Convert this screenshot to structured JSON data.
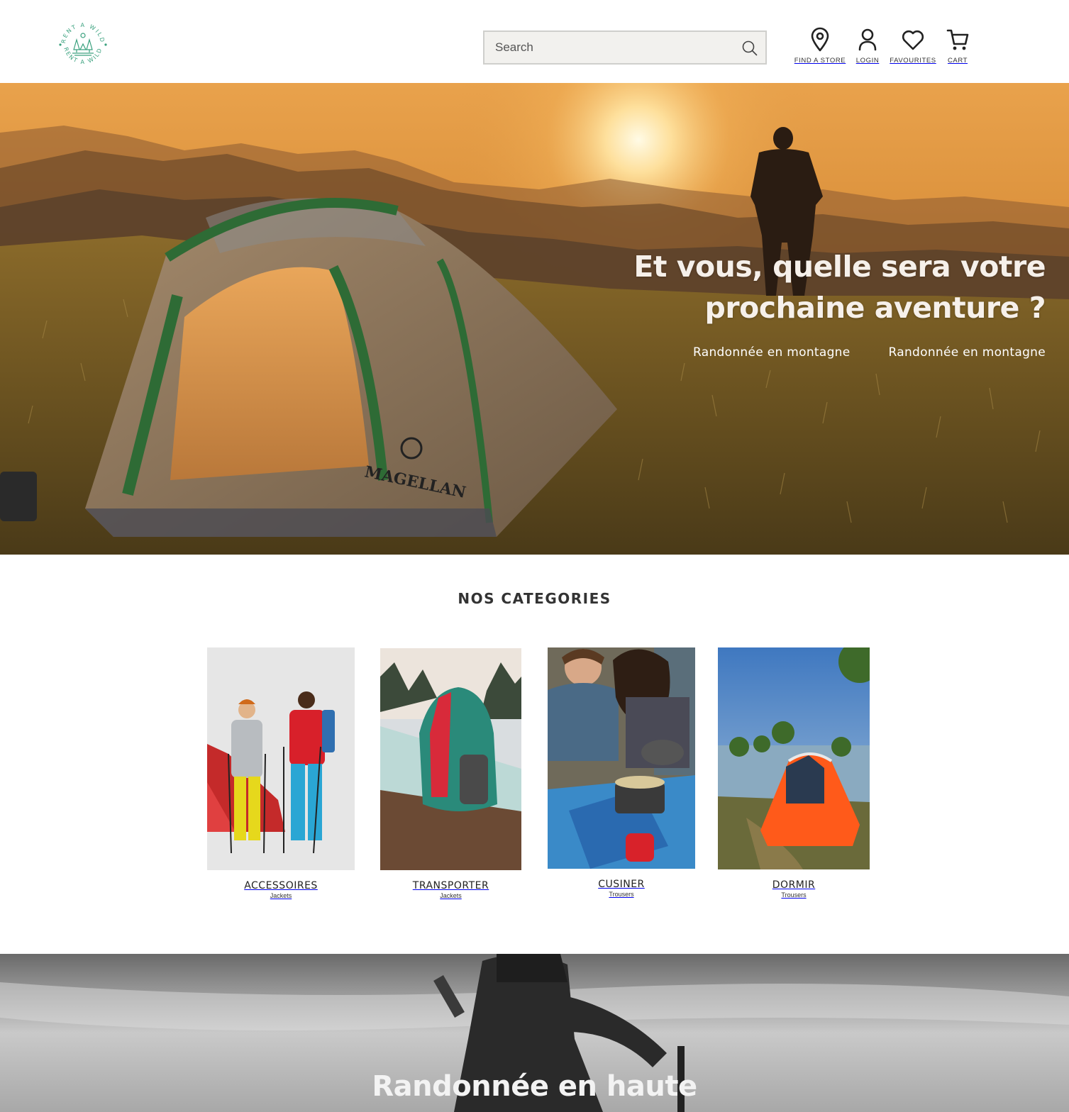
{
  "brand": {
    "logo_alt": "Rent a Wild",
    "logo_text_top": "RENT A WILD",
    "logo_text_bottom": "RENT A WILD",
    "accent_color": "#3aa17e"
  },
  "search": {
    "placeholder": "Search",
    "value": "",
    "icon": "search-icon"
  },
  "nav": [
    {
      "label": "FIND A STORE",
      "icon": "map-pin-icon"
    },
    {
      "label": "LOGIN",
      "icon": "user-icon"
    },
    {
      "label": "FAVOURITES",
      "icon": "heart-icon"
    },
    {
      "label": "CART",
      "icon": "cart-icon"
    }
  ],
  "hero": {
    "title_line1": "Et vous, quelle sera votre",
    "title_line2": "prochaine aventure ?",
    "links": [
      "Randonnée en montagne",
      "Randonnée en montagne"
    ],
    "tent_brand": "MAGELLAN"
  },
  "categories": {
    "title": "NOS CATEGORIES",
    "items": [
      {
        "name": "ACCESSOIRES",
        "sub": "Jackets"
      },
      {
        "name": "TRANSPORTER",
        "sub": "Jackets"
      },
      {
        "name": "CUSINER",
        "sub": "Trousers"
      },
      {
        "name": "DORMIR",
        "sub": "Trousers"
      }
    ]
  },
  "banner": {
    "title": "Randonnée en haute"
  }
}
